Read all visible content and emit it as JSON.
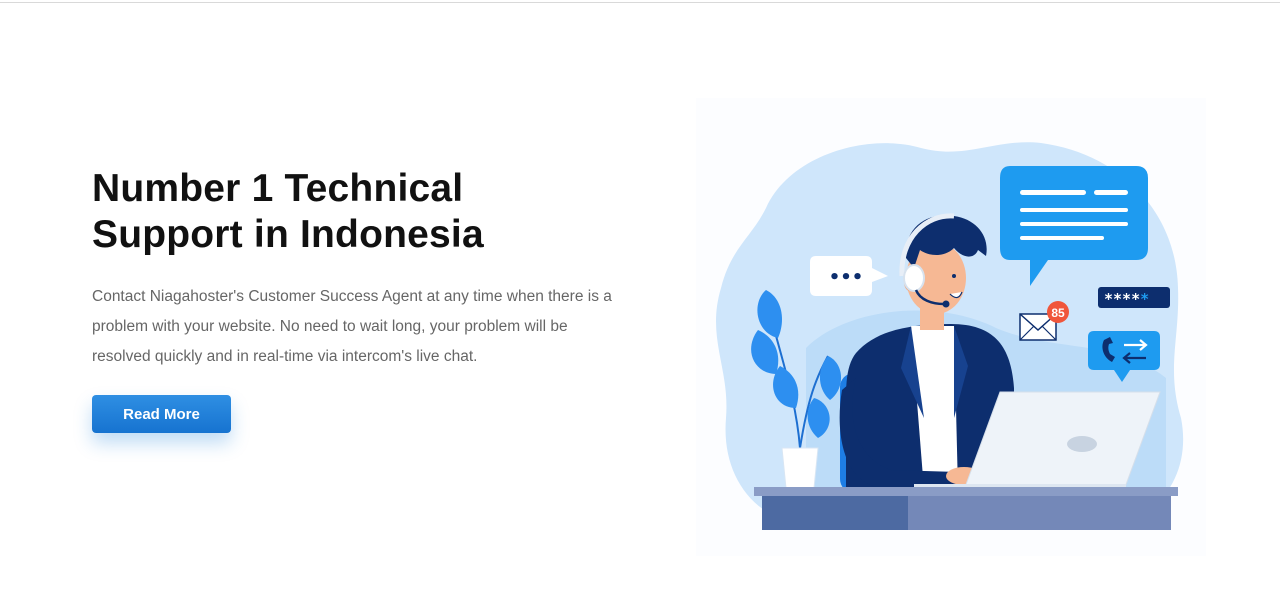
{
  "hero": {
    "title": "Number 1 Technical Support in Indonesia",
    "description": "Contact Niagahoster's Customer Success Agent at any time when there is a problem with your website. No need to wait long, your problem will be resolved quickly and in real-time via intercom's live chat.",
    "read_more_label": "Read More"
  },
  "illustration": {
    "notification_count": "85",
    "password_mask": "****",
    "password_cursor": "*",
    "typing_dots": "•••",
    "colors": {
      "primary_blue": "#1E9BF0",
      "dark_navy": "#0D2E6E",
      "light_blue": "#BFE0FB",
      "desk_blue": "#5B73A8",
      "badge_red": "#F0563B"
    }
  }
}
